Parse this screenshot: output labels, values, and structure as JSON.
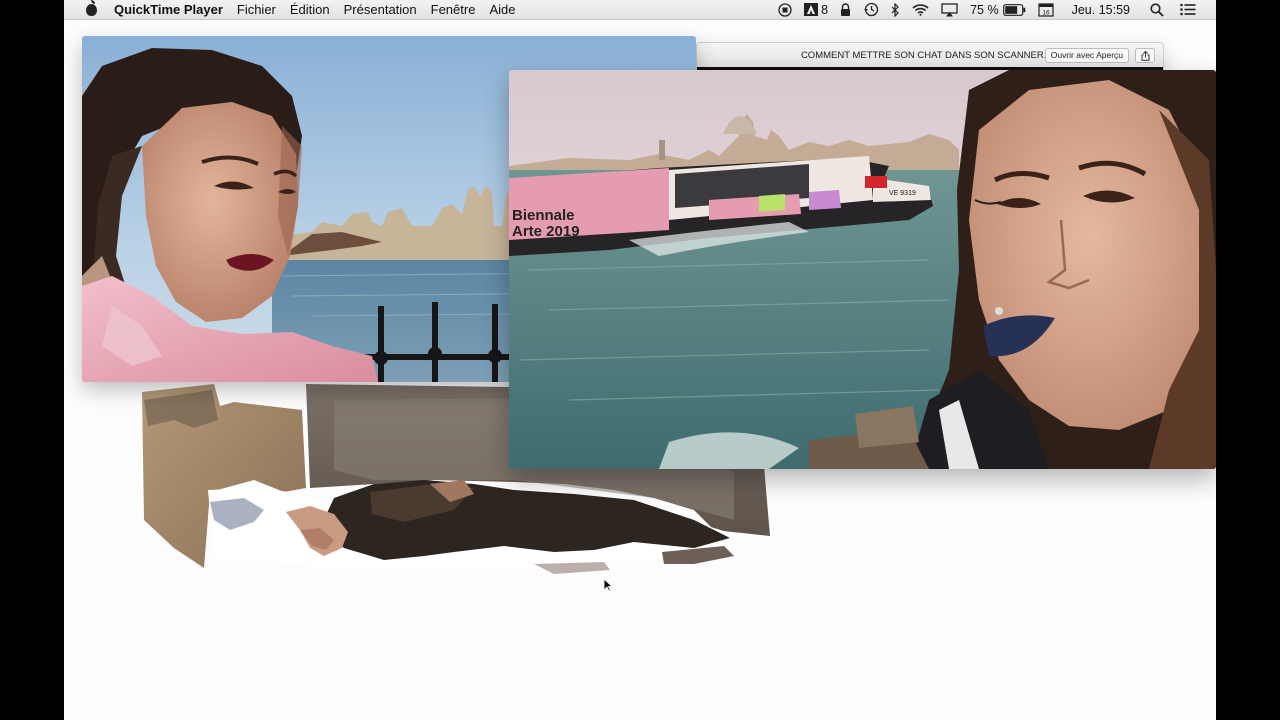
{
  "menubar": {
    "app_name": "QuickTime Player",
    "menus": [
      "Fichier",
      "Édition",
      "Présentation",
      "Fenêtre",
      "Aide"
    ],
    "status": {
      "adobe_count": "8",
      "battery_percent": "75 %",
      "calendar_day": "16",
      "clock": "Jeu. 15:59"
    },
    "icons": [
      "apple-icon",
      "record-icon",
      "adobe-icon",
      "lock-icon",
      "time-machine-icon",
      "bluetooth-icon",
      "wifi-icon",
      "airplay-icon",
      "battery-icon",
      "calendar-icon",
      "spotlight-icon",
      "notification-center-icon"
    ]
  },
  "preview": {
    "title": "COMMENT METTRE SON CHAT DANS SON SCANNER.jpg",
    "open_button": "Ouvrir avec Aperçu",
    "share_icon": "share-icon"
  },
  "media": {
    "video_newyork": "video-newyork",
    "video_venice": "video-venice",
    "boat_text_line1": "Biennale",
    "boat_text_line2": "Arte 2019",
    "boat_id": "VE 9319",
    "scan": "scanner-image"
  },
  "colors": {
    "menubar": "#e8e8e8",
    "desktop": "#fdfdfd",
    "sky_ny": "#a9c8e6",
    "water_venice": "#4f7e80",
    "boat_pink": "#e69cb0"
  }
}
